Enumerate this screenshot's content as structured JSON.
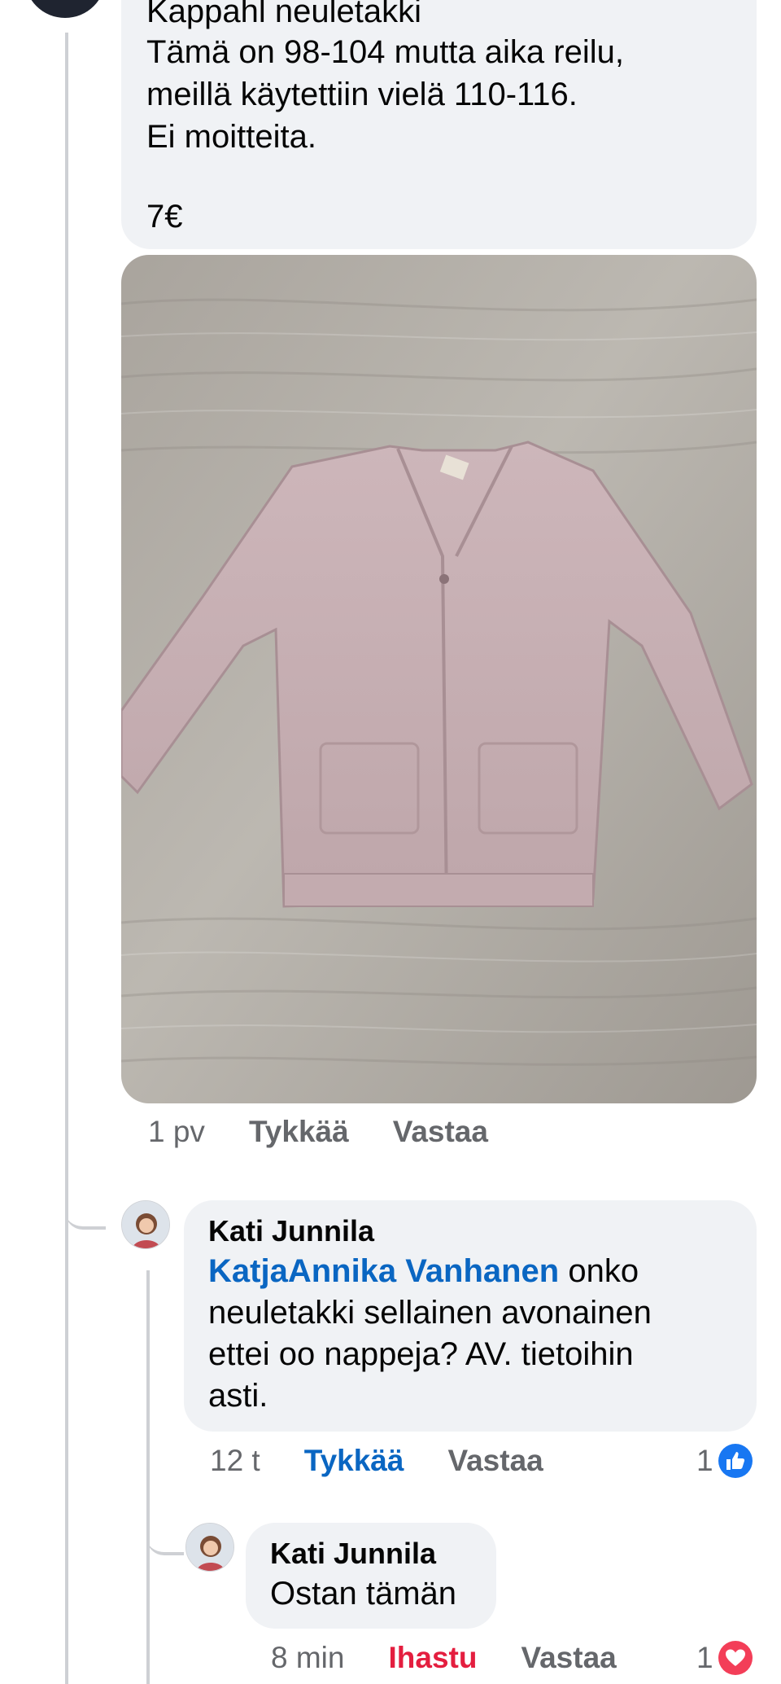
{
  "post": {
    "lines": [
      "Kappahl neuletakki",
      "Tämä on 98-104 mutta aika reilu,",
      "meillä käytettiin vielä 110-116.",
      "Ei moitteita."
    ],
    "price": "7€",
    "photo_alt": "Vaaleanpunainen neuletakki puulattialla",
    "actions": {
      "time": "1 pv",
      "like": "Tykkää",
      "reply": "Vastaa"
    }
  },
  "comments": [
    {
      "author": "Kati Junnila",
      "mention": "KatjaAnnika Vanhanen",
      "text_lines": [
        " onko",
        "neuletakki sellainen avonainen",
        "ettei oo nappeja? AV. tietoihin",
        "asti."
      ],
      "time": "12 t",
      "like": "Tykkää",
      "reply": "Vastaa",
      "reaction_count": "1",
      "reaction_icon": "like-thumb-icon",
      "reaction_color": "#1877f2"
    },
    {
      "author": "Kati Junnila",
      "text": "Ostan tämän",
      "time": "8 min",
      "like": "Ihastu",
      "reply": "Vastaa",
      "reaction_count": "1",
      "reaction_icon": "love-heart-icon",
      "reaction_color": "#f33e58"
    }
  ],
  "colors": {
    "accent_blue": "#0a66c2",
    "love_red": "#e41e3f",
    "bubble_bg": "#f0f2f5",
    "meta_gray": "#65676b"
  }
}
